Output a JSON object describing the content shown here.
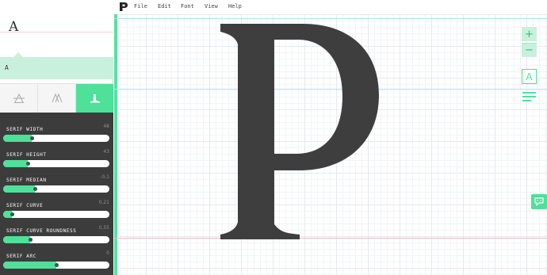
{
  "menu": {
    "items": [
      "File",
      "Edit",
      "Font",
      "View",
      "Help"
    ]
  },
  "sidebar": {
    "glyph_preview_char": "A",
    "typing_text": "A",
    "tabs": [
      {
        "icon": "strike-a-icon",
        "active": false
      },
      {
        "icon": "outline-a-icon",
        "active": false
      },
      {
        "icon": "serif-icon",
        "active": true
      }
    ],
    "params": [
      {
        "label": "Serif width",
        "value": "48",
        "fraction": 0.27
      },
      {
        "label": "Serif height",
        "value": "43",
        "fraction": 0.23
      },
      {
        "label": "Serif median",
        "value": "-0,1",
        "fraction": 0.3
      },
      {
        "label": "Serif curve",
        "value": "0,21",
        "fraction": 0.08
      },
      {
        "label": "Serif curve roundness",
        "value": "0,55",
        "fraction": 0.25
      },
      {
        "label": "Serif arc",
        "value": "0",
        "fraction": 0.5
      }
    ]
  },
  "canvas": {
    "glyph": "P",
    "toolbar": {
      "zoom_in": "+",
      "zoom_out": "−",
      "font_button": "A"
    }
  },
  "colors": {
    "accent": "#4fe09a",
    "accent_light": "#c9f0dc",
    "panel_dark": "#3c3c3c",
    "glyph_fill": "#3e3e3e",
    "guide_cyan": "#a6e6ee",
    "guide_pink": "#f5b8c0"
  }
}
